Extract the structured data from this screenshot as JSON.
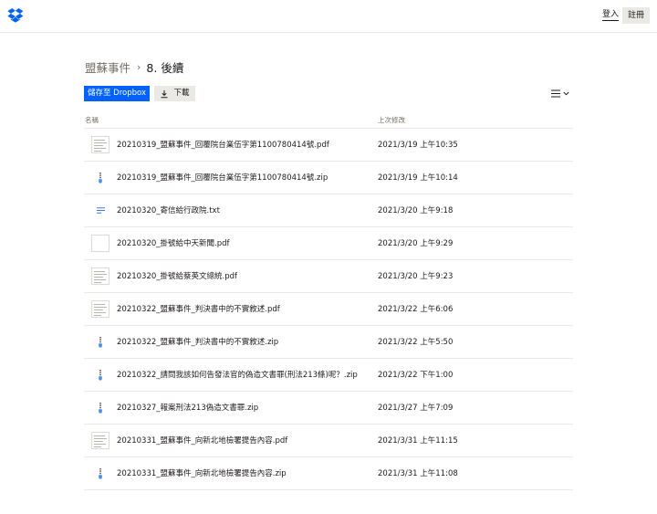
{
  "header": {
    "login_label": "登入",
    "signup_label": "註冊",
    "brand_color": "#0061fe"
  },
  "breadcrumb": {
    "parent": "盟蘇事件",
    "separator": "›",
    "current": "8. 後續"
  },
  "toolbar": {
    "save_label": "儲存至 Dropbox",
    "download_label": "下載",
    "view_icon": "list-view-icon"
  },
  "columns": {
    "name": "名稱",
    "modified": "上次修改"
  },
  "files": [
    {
      "name": "20210319_盟蘇事件_回覆院台業伍字第1100780414號.pdf",
      "modified": "2021/3/19 上午10:35",
      "type": "pdf"
    },
    {
      "name": "20210319_盟蘇事件_回覆院台業伍字第1100780414號.zip",
      "modified": "2021/3/19 上午10:14",
      "type": "zip"
    },
    {
      "name": "20210320_寄信給行政院.txt",
      "modified": "2021/3/20 上午9:18",
      "type": "txt"
    },
    {
      "name": "20210320_掛號給中天新聞.pdf",
      "modified": "2021/3/20 上午9:29",
      "type": "pdf-blank"
    },
    {
      "name": "20210320_掛號給蔡英文總統.pdf",
      "modified": "2021/3/20 上午9:23",
      "type": "pdf"
    },
    {
      "name": "20210322_盟蘇事件_判決書中的不實敘述.pdf",
      "modified": "2021/3/22 上午6:06",
      "type": "pdf"
    },
    {
      "name": "20210322_盟蘇事件_判決書中的不實敘述.zip",
      "modified": "2021/3/22 上午5:50",
      "type": "zip"
    },
    {
      "name": "20210322_請問我該如何告發法官的偽造文書罪(刑法213條)呢？.zip",
      "modified": "2021/3/22 下午1:00",
      "type": "zip"
    },
    {
      "name": "20210327_報案刑法213偽造文書罪.zip",
      "modified": "2021/3/27 上午7:09",
      "type": "zip"
    },
    {
      "name": "20210331_盟蘇事件_向新北地檢署提告內容.pdf",
      "modified": "2021/3/31 上午11:15",
      "type": "pdf"
    },
    {
      "name": "20210331_盟蘇事件_向新北地檢署提告內容.zip",
      "modified": "2021/3/31 上午11:08",
      "type": "zip"
    }
  ]
}
